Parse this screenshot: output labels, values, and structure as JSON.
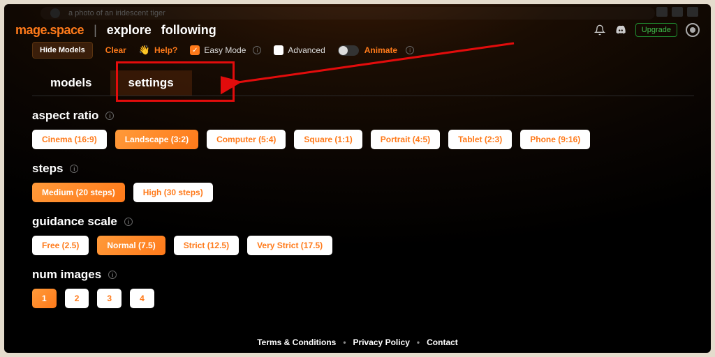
{
  "search": {
    "placeholder": "a photo of an iridescent tiger"
  },
  "header": {
    "logo": "mage.space",
    "nav": {
      "explore": "explore",
      "following": "following"
    },
    "upgrade": "Upgrade"
  },
  "toolbar": {
    "hide_models": "Hide Models",
    "clear": "Clear",
    "help": "Help?",
    "easy_mode": "Easy Mode",
    "advanced": "Advanced",
    "animate": "Animate"
  },
  "tabs": {
    "models": "models",
    "settings": "settings"
  },
  "sections": {
    "aspect_ratio": {
      "title": "aspect ratio",
      "options": [
        "Cinema (16:9)",
        "Landscape (3:2)",
        "Computer (5:4)",
        "Square (1:1)",
        "Portrait (4:5)",
        "Tablet (2:3)",
        "Phone (9:16)"
      ],
      "active_index": 1
    },
    "steps": {
      "title": "steps",
      "options": [
        "Medium (20 steps)",
        "High (30 steps)"
      ],
      "active_index": 0
    },
    "guidance": {
      "title": "guidance scale",
      "options": [
        "Free (2.5)",
        "Normal (7.5)",
        "Strict (12.5)",
        "Very Strict (17.5)"
      ],
      "active_index": 1
    },
    "num_images": {
      "title": "num images",
      "options": [
        "1",
        "2",
        "3",
        "4"
      ],
      "active_index": 0
    }
  },
  "footer": {
    "terms": "Terms & Conditions",
    "privacy": "Privacy Policy",
    "contact": "Contact"
  }
}
